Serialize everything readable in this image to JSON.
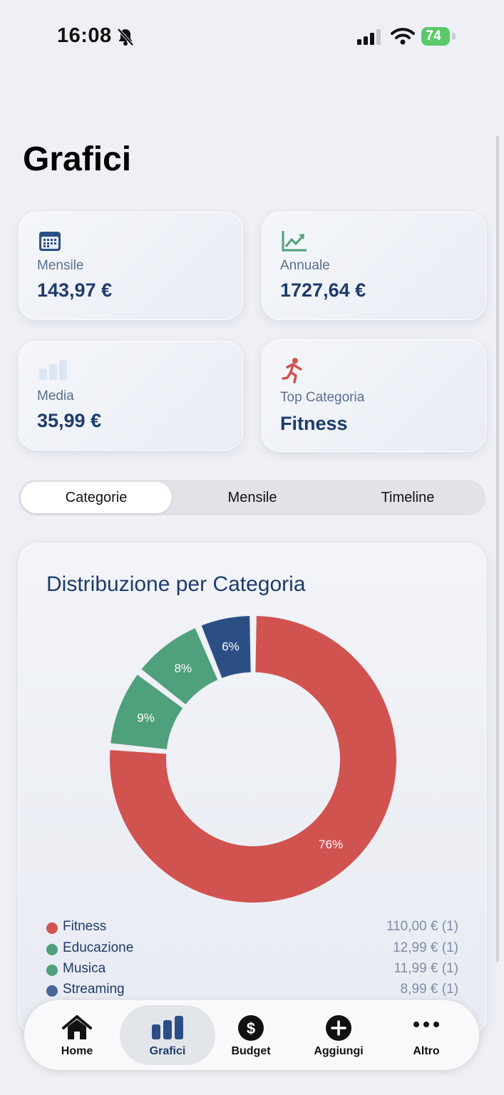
{
  "status_bar": {
    "time": "16:08",
    "battery": "74"
  },
  "page": {
    "title": "Grafici"
  },
  "stats": {
    "monthly": {
      "label": "Mensile",
      "value": "143,97 €",
      "icon": "calendar-icon"
    },
    "annual": {
      "label": "Annuale",
      "value": "1727,64 €",
      "icon": "trend-up-icon"
    },
    "average": {
      "label": "Media",
      "value": "35,99 €",
      "icon": "bar-chart-icon"
    },
    "top": {
      "label": "Top Categoria",
      "value": "Fitness",
      "icon": "running-icon"
    }
  },
  "segments": {
    "categories": "Categorie",
    "monthly": "Mensile",
    "timeline": "Timeline",
    "selected": "Categorie"
  },
  "chart_title": "Distribuzione per Categoria",
  "chart_data": {
    "type": "pie",
    "categories": [
      "Fitness",
      "Educazione",
      "Musica",
      "Streaming"
    ],
    "values": [
      110.0,
      12.99,
      11.99,
      8.99
    ],
    "percent_labels": [
      "76%",
      "9%",
      "8%",
      "6%"
    ],
    "colors": [
      "#d05350",
      "#4fa07c",
      "#4fa07c",
      "#2b4f85"
    ]
  },
  "legend": [
    {
      "name": "Fitness",
      "amount": "110,00 €",
      "count": "(1)",
      "color": "#d05350"
    },
    {
      "name": "Educazione",
      "amount": "12,99 €",
      "count": "(1)",
      "color": "#4fa07c"
    },
    {
      "name": "Musica",
      "amount": "11,99 €",
      "count": "(1)",
      "color": "#4fa07c"
    },
    {
      "name": "Streaming",
      "amount": "8,99 €",
      "count": "(1)",
      "color": "#4a6696"
    }
  ],
  "tabbar": {
    "home": "Home",
    "charts": "Grafici",
    "budget": "Budget",
    "add": "Aggiungi",
    "more": "Altro"
  }
}
